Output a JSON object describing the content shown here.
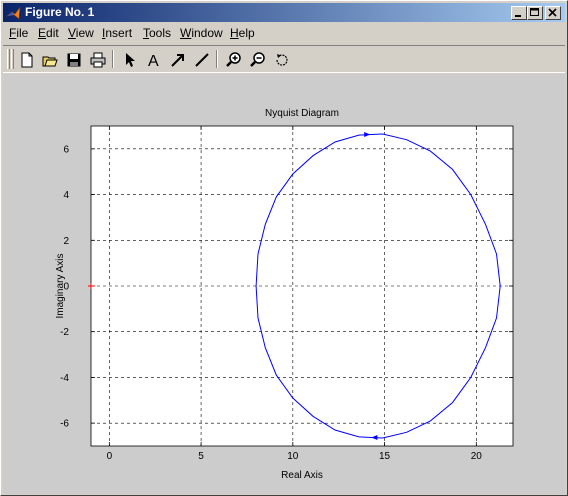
{
  "window": {
    "title": "Figure No. 1"
  },
  "menubar": {
    "items": [
      "File",
      "Edit",
      "View",
      "Insert",
      "Tools",
      "Window",
      "Help"
    ],
    "underline": [
      "F",
      "E",
      "V",
      "I",
      "T",
      "W",
      "H"
    ]
  },
  "toolbar": {
    "icons": [
      "new-figure-icon",
      "open-file-icon",
      "save-icon",
      "print-icon",
      "edit-plot-arrow-icon",
      "insert-text-icon",
      "insert-arrow-icon",
      "insert-line-icon",
      "zoom-in-icon",
      "zoom-out-icon",
      "rotate-3d-icon"
    ]
  },
  "colors": {
    "curve": "#0000ff",
    "critical_point": "#ff0000",
    "axes_bg": "#ffffff",
    "figure_bg": "#cccccc",
    "titlebar_start": "#0a246a",
    "titlebar_end": "#a6caf0"
  },
  "chart_data": {
    "type": "line",
    "title": "Nyquist Diagram",
    "xlabel": "Real Axis",
    "ylabel": "Imaginary Axis",
    "xlim": [
      -1,
      22
    ],
    "ylim": [
      -7,
      7
    ],
    "xticks": [
      0,
      5,
      10,
      15,
      20
    ],
    "yticks": [
      -6,
      -4,
      -2,
      0,
      2,
      4,
      6
    ],
    "grid": true,
    "series": [
      {
        "x": [
          8.0,
          8.1,
          8.5,
          9.1,
          10.0,
          11.1,
          12.3,
          13.6,
          14.9,
          16.2,
          17.5,
          18.7,
          19.7,
          20.5,
          21.1,
          21.3,
          21.1,
          20.5,
          19.7,
          18.7,
          17.5,
          16.2,
          14.9,
          13.6,
          12.3,
          11.1,
          10.0,
          9.1,
          8.5,
          8.1,
          8.0
        ],
        "y": [
          0.0,
          1.4,
          2.7,
          3.9,
          4.9,
          5.7,
          6.3,
          6.6,
          6.65,
          6.4,
          5.9,
          5.1,
          4.0,
          2.7,
          1.4,
          0.0,
          -1.4,
          -2.7,
          -4.0,
          -5.1,
          -5.9,
          -6.4,
          -6.65,
          -6.6,
          -6.3,
          -5.7,
          -4.9,
          -3.9,
          -2.7,
          -1.4,
          0.0
        ]
      }
    ],
    "arrows": [
      {
        "x": 14.0,
        "y": 6.63,
        "direction": "right"
      },
      {
        "x": 14.5,
        "y": -6.63,
        "direction": "left"
      }
    ],
    "critical_point": {
      "x": -1,
      "y": 0,
      "marker": "+"
    }
  }
}
